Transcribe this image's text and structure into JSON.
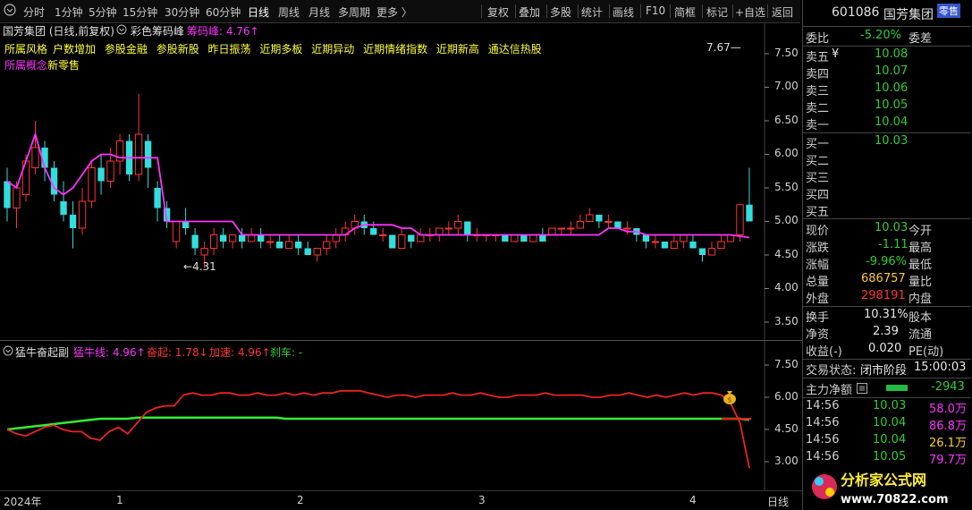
{
  "toolbar": {
    "period_tabs": [
      "分时",
      "1分钟",
      "5分钟",
      "15分钟",
      "30分钟",
      "60分钟",
      "日线",
      "周线",
      "月线",
      "多周期",
      "更多 〉"
    ],
    "active_tab": "日线",
    "tools": [
      "复权",
      "叠加",
      "多股",
      "统计",
      "画线",
      "F10",
      "简框",
      "标记",
      "+自选",
      "返回"
    ]
  },
  "main": {
    "title": "国芳集团 (日线,前复权)",
    "indicator_name": "彩色筹码峰",
    "indicator_value_label": "筹码峰: 4.76↑",
    "concepts_line1": [
      "所属风格",
      "户数增加",
      "参股金融",
      "参股新股",
      "昨日振荡",
      "近期多板",
      "近期异动",
      "近期情绪指数",
      "近期新高",
      "通达信热股"
    ],
    "concepts_line2_prefix": "所属概念",
    "concepts_line2": "新零售",
    "y_ticks": [
      "7.50",
      "7.00",
      "6.50",
      "6.00",
      "5.50",
      "5.00",
      "4.50",
      "4.00",
      "3.50"
    ],
    "low_label": "4.31",
    "high_label": "7.67"
  },
  "sub": {
    "indicator_name": "猛牛奋起副",
    "line1_label": "猛牛线: 4.96↑",
    "line2_label": "奋起: 1.78↓",
    "line3_label": "加速: 4.96↑",
    "line4_label": "刹车: -",
    "y_ticks": [
      "7.50",
      "6.00",
      "4.50",
      "3.00"
    ]
  },
  "x_axis": {
    "labels": [
      "2024年",
      "1",
      "2",
      "3",
      "4"
    ],
    "unit": "日线"
  },
  "chart_data": {
    "type": "candlestick",
    "title": "国芳集团 (日线,前复权)",
    "ylim": [
      3.2,
      7.8
    ],
    "candles": [
      {
        "o": 5.6,
        "c": 5.2,
        "h": 5.8,
        "l": 5.0
      },
      {
        "o": 5.2,
        "c": 5.5,
        "h": 5.6,
        "l": 4.9
      },
      {
        "o": 5.4,
        "c": 5.9,
        "h": 6.0,
        "l": 5.3
      },
      {
        "o": 5.8,
        "c": 6.1,
        "h": 6.5,
        "l": 5.7
      },
      {
        "o": 6.1,
        "c": 5.8,
        "h": 6.2,
        "l": 5.6
      },
      {
        "o": 5.8,
        "c": 5.4,
        "h": 5.9,
        "l": 5.3
      },
      {
        "o": 5.3,
        "c": 5.1,
        "h": 5.6,
        "l": 5.0
      },
      {
        "o": 5.1,
        "c": 4.9,
        "h": 5.3,
        "l": 4.6
      },
      {
        "o": 4.9,
        "c": 5.3,
        "h": 5.5,
        "l": 4.8
      },
      {
        "o": 5.3,
        "c": 5.8,
        "h": 5.9,
        "l": 5.2
      },
      {
        "o": 5.8,
        "c": 5.6,
        "h": 6.0,
        "l": 5.4
      },
      {
        "o": 5.6,
        "c": 5.9,
        "h": 6.1,
        "l": 5.5
      },
      {
        "o": 5.9,
        "c": 6.2,
        "h": 6.3,
        "l": 5.7
      },
      {
        "o": 6.2,
        "c": 5.7,
        "h": 6.3,
        "l": 5.6
      },
      {
        "o": 5.7,
        "c": 6.3,
        "h": 6.9,
        "l": 5.6
      },
      {
        "o": 6.2,
        "c": 5.8,
        "h": 6.3,
        "l": 5.5
      },
      {
        "o": 5.5,
        "c": 5.2,
        "h": 5.6,
        "l": 5.0
      },
      {
        "o": 5.2,
        "c": 5.0,
        "h": 5.3,
        "l": 4.9
      },
      {
        "o": 4.7,
        "c": 5.0,
        "h": 5.0,
        "l": 4.6
      },
      {
        "o": 5.0,
        "c": 4.9,
        "h": 5.2,
        "l": 4.8
      },
      {
        "o": 4.8,
        "c": 4.6,
        "h": 4.9,
        "l": 4.5
      },
      {
        "o": 4.5,
        "c": 4.6,
        "h": 4.7,
        "l": 4.31
      },
      {
        "o": 4.6,
        "c": 4.8,
        "h": 4.9,
        "l": 4.5
      },
      {
        "o": 4.8,
        "c": 4.7,
        "h": 4.9,
        "l": 4.6
      },
      {
        "o": 4.7,
        "c": 4.8,
        "h": 4.8,
        "l": 4.6
      },
      {
        "o": 4.8,
        "c": 4.7,
        "h": 4.9,
        "l": 4.6
      },
      {
        "o": 4.7,
        "c": 4.8,
        "h": 4.9,
        "l": 4.7
      },
      {
        "o": 4.8,
        "c": 4.7,
        "h": 4.9,
        "l": 4.6
      },
      {
        "o": 4.7,
        "c": 4.7,
        "h": 4.8,
        "l": 4.6
      },
      {
        "o": 4.7,
        "c": 4.6,
        "h": 4.8,
        "l": 4.6
      },
      {
        "o": 4.6,
        "c": 4.7,
        "h": 4.8,
        "l": 4.6
      },
      {
        "o": 4.7,
        "c": 4.6,
        "h": 4.8,
        "l": 4.5
      },
      {
        "o": 4.6,
        "c": 4.5,
        "h": 4.7,
        "l": 4.5
      },
      {
        "o": 4.5,
        "c": 4.6,
        "h": 4.6,
        "l": 4.4
      },
      {
        "o": 4.6,
        "c": 4.7,
        "h": 4.8,
        "l": 4.5
      },
      {
        "o": 4.7,
        "c": 4.8,
        "h": 4.9,
        "l": 4.6
      },
      {
        "o": 4.8,
        "c": 4.9,
        "h": 5.0,
        "l": 4.7
      },
      {
        "o": 4.9,
        "c": 5.0,
        "h": 5.1,
        "l": 4.8
      },
      {
        "o": 5.0,
        "c": 4.9,
        "h": 5.1,
        "l": 4.8
      },
      {
        "o": 4.9,
        "c": 4.8,
        "h": 5.0,
        "l": 4.8
      },
      {
        "o": 4.8,
        "c": 4.8,
        "h": 4.9,
        "l": 4.7
      },
      {
        "o": 4.8,
        "c": 4.6,
        "h": 4.8,
        "l": 4.6
      },
      {
        "o": 4.6,
        "c": 4.8,
        "h": 4.9,
        "l": 4.6
      },
      {
        "o": 4.8,
        "c": 4.7,
        "h": 4.8,
        "l": 4.6
      },
      {
        "o": 4.7,
        "c": 4.8,
        "h": 4.9,
        "l": 4.7
      },
      {
        "o": 4.8,
        "c": 4.8,
        "h": 4.9,
        "l": 4.7
      },
      {
        "o": 4.8,
        "c": 4.9,
        "h": 4.9,
        "l": 4.7
      },
      {
        "o": 4.9,
        "c": 4.9,
        "h": 5.0,
        "l": 4.8
      },
      {
        "o": 4.9,
        "c": 5.0,
        "h": 5.1,
        "l": 4.8
      },
      {
        "o": 5.0,
        "c": 4.8,
        "h": 5.0,
        "l": 4.7
      },
      {
        "o": 4.8,
        "c": 4.8,
        "h": 4.9,
        "l": 4.7
      },
      {
        "o": 4.8,
        "c": 4.8,
        "h": 4.8,
        "l": 4.7
      },
      {
        "o": 4.8,
        "c": 4.8,
        "h": 4.8,
        "l": 4.7
      },
      {
        "o": 4.8,
        "c": 4.7,
        "h": 4.8,
        "l": 4.7
      },
      {
        "o": 4.7,
        "c": 4.8,
        "h": 4.8,
        "l": 4.7
      },
      {
        "o": 4.8,
        "c": 4.7,
        "h": 4.8,
        "l": 4.7
      },
      {
        "o": 4.7,
        "c": 4.8,
        "h": 4.8,
        "l": 4.7
      },
      {
        "o": 4.8,
        "c": 4.7,
        "h": 4.9,
        "l": 4.7
      },
      {
        "o": 4.8,
        "c": 4.9,
        "h": 4.9,
        "l": 4.8
      },
      {
        "o": 4.9,
        "c": 4.9,
        "h": 4.9,
        "l": 4.8
      },
      {
        "o": 4.9,
        "c": 4.9,
        "h": 5.0,
        "l": 4.8
      },
      {
        "o": 4.9,
        "c": 5.0,
        "h": 5.1,
        "l": 4.9
      },
      {
        "o": 5.0,
        "c": 5.1,
        "h": 5.2,
        "l": 5.0
      },
      {
        "o": 5.1,
        "c": 5.0,
        "h": 5.1,
        "l": 4.9
      },
      {
        "o": 5.0,
        "c": 5.0,
        "h": 5.1,
        "l": 4.9
      },
      {
        "o": 5.0,
        "c": 4.9,
        "h": 5.0,
        "l": 4.9
      },
      {
        "o": 4.9,
        "c": 4.9,
        "h": 5.0,
        "l": 4.8
      },
      {
        "o": 4.9,
        "c": 4.8,
        "h": 4.9,
        "l": 4.7
      },
      {
        "o": 4.8,
        "c": 4.7,
        "h": 4.8,
        "l": 4.6
      },
      {
        "o": 4.7,
        "c": 4.7,
        "h": 4.8,
        "l": 4.6
      },
      {
        "o": 4.7,
        "c": 4.6,
        "h": 4.7,
        "l": 4.6
      },
      {
        "o": 4.6,
        "c": 4.7,
        "h": 4.8,
        "l": 4.6
      },
      {
        "o": 4.7,
        "c": 4.8,
        "h": 4.8,
        "l": 4.6
      },
      {
        "o": 4.7,
        "c": 4.6,
        "h": 4.8,
        "l": 4.6
      },
      {
        "o": 4.6,
        "c": 4.5,
        "h": 4.6,
        "l": 4.4
      },
      {
        "o": 4.5,
        "c": 4.6,
        "h": 4.7,
        "l": 4.5
      },
      {
        "o": 4.6,
        "c": 4.7,
        "h": 4.8,
        "l": 4.6
      },
      {
        "o": 4.7,
        "c": 4.8,
        "h": 4.8,
        "l": 4.7
      },
      {
        "o": 4.8,
        "c": 5.25,
        "h": 5.25,
        "l": 4.7
      },
      {
        "o": 5.25,
        "c": 5.0,
        "h": 5.8,
        "l": 5.0
      }
    ],
    "chip_peak_line": [
      5.6,
      5.5,
      5.9,
      6.3,
      5.8,
      5.5,
      5.4,
      5.5,
      5.7,
      5.9,
      6.0,
      6.0,
      5.95,
      5.95,
      5.95,
      5.95,
      5.95,
      5.0,
      5.0,
      5.0,
      5.0,
      5.0,
      5.0,
      5.0,
      5.0,
      4.8,
      4.8,
      4.8,
      4.8,
      4.8,
      4.8,
      4.8,
      4.8,
      4.8,
      4.8,
      4.8,
      4.8,
      4.9,
      4.95,
      4.95,
      4.95,
      4.95,
      4.9,
      4.9,
      4.8,
      4.8,
      4.8,
      4.8,
      4.8,
      4.8,
      4.8,
      4.8,
      4.8,
      4.8,
      4.8,
      4.8,
      4.8,
      4.8,
      4.8,
      4.8,
      4.8,
      4.8,
      4.8,
      4.8,
      4.9,
      4.9,
      4.85,
      4.85,
      4.8,
      4.8,
      4.8,
      4.8,
      4.8,
      4.8,
      4.8,
      4.8,
      4.8,
      4.8,
      4.78,
      4.76
    ],
    "sub_series": {
      "ylim": [
        2.5,
        8.0
      ],
      "red": [
        4.5,
        4.3,
        4.2,
        4.4,
        4.6,
        4.7,
        4.5,
        4.4,
        4.4,
        4.1,
        4.0,
        4.4,
        4.6,
        4.3,
        4.8,
        5.3,
        5.5,
        5.6,
        5.6,
        6.1,
        6.2,
        6.1,
        6.1,
        6.2,
        6.2,
        6.1,
        6.1,
        6.2,
        6.1,
        6.1,
        6.2,
        6.1,
        6.2,
        6.1,
        6.2,
        6.2,
        6.3,
        6.3,
        6.3,
        6.2,
        6.1,
        6.0,
        6.1,
        6.1,
        6.0,
        6.1,
        6.1,
        6.1,
        6.2,
        6.1,
        6.1,
        6.2,
        6.1,
        6.0,
        6.0,
        6.1,
        6.1,
        6.1,
        6.2,
        6.1,
        6.1,
        6.1,
        6.1,
        6.0,
        6.0,
        6.1,
        6.1,
        6.2,
        6.1,
        6.0,
        6.1,
        6.0,
        6.1,
        6.2,
        6.1,
        6.2,
        6.2,
        6.1,
        5.7,
        4.8,
        2.7
      ],
      "green": [
        4.5,
        4.55,
        4.6,
        4.65,
        4.7,
        4.75,
        4.8,
        4.85,
        4.9,
        4.95,
        5.0,
        5.0,
        5.0,
        5.0,
        5.05,
        5.05,
        5.05,
        5.05,
        5.05,
        5.05,
        5.05,
        5.05,
        5.05,
        5.05,
        5.05,
        5.05,
        5.05,
        5.05,
        5.05,
        5.05,
        5.0,
        5.0,
        5.0,
        5.0,
        5.0,
        5.0,
        5.0,
        5.0,
        5.0,
        5.0,
        5.0,
        5.0,
        5.0,
        5.0,
        5.0,
        5.0,
        5.0,
        5.0,
        5.0,
        5.0,
        5.0,
        5.0,
        5.0,
        5.0,
        5.0,
        5.0,
        5.0,
        5.0,
        5.0,
        5.0,
        5.0,
        5.0,
        5.0,
        5.0,
        5.0,
        5.0,
        5.0,
        5.0,
        5.0,
        5.0,
        5.0,
        5.0,
        5.0,
        5.0,
        5.0,
        5.0,
        5.0,
        5.0,
        5.0,
        5.0,
        4.96
      ],
      "level_line": 5.0
    }
  },
  "quote": {
    "code": "601086",
    "name": "国芳集团",
    "status_tag": "零售",
    "weibi_label": "委比",
    "weibi_value": "-5.20%",
    "weicha_label": "委差",
    "sells": [
      {
        "label": "卖五",
        "flag": "¥",
        "price": "10.08"
      },
      {
        "label": "卖四",
        "flag": "",
        "price": "10.07"
      },
      {
        "label": "卖三",
        "flag": "",
        "price": "10.06"
      },
      {
        "label": "卖二",
        "flag": "",
        "price": "10.05"
      },
      {
        "label": "卖一",
        "flag": "",
        "price": "10.04"
      }
    ],
    "buys": [
      {
        "label": "买一",
        "price": "10.03"
      },
      {
        "label": "买二",
        "price": ""
      },
      {
        "label": "买三",
        "price": ""
      },
      {
        "label": "买四",
        "price": ""
      },
      {
        "label": "买五",
        "price": ""
      }
    ],
    "stats": [
      {
        "l1": "现价",
        "v1": "10.03",
        "c1": "green",
        "l2": "今开"
      },
      {
        "l1": "涨跌",
        "v1": "-1.11",
        "c1": "green",
        "l2": "最高"
      },
      {
        "l1": "涨幅",
        "v1": "-9.96%",
        "c1": "green",
        "l2": "最低"
      },
      {
        "l1": "总量",
        "v1": "686757",
        "c1": "yellow",
        "l2": "量比"
      },
      {
        "l1": "外盘",
        "v1": "298191",
        "c1": "red",
        "l2": "内盘"
      }
    ],
    "stats2": [
      {
        "l1": "换手",
        "v1": "10.31%",
        "c1": "white",
        "l2": "股本"
      },
      {
        "l1": "净资",
        "v1": "2.39",
        "c1": "white",
        "l2": "流通"
      },
      {
        "l1": "收益(-)",
        "v1": "0.020",
        "c1": "white",
        "l2": "PE(动)"
      }
    ],
    "trade_status_label": "交易状态:",
    "trade_status": "闭市阶段",
    "trade_time": "15:00:03",
    "main_net_label": "主力净额",
    "main_net_value": "-2943",
    "ticks": [
      {
        "time": "14:56",
        "price": "10.03",
        "vol": "58.0万",
        "vc": "magenta"
      },
      {
        "time": "14:56",
        "price": "10.04",
        "vol": "86.8万",
        "vc": "magenta"
      },
      {
        "time": "14:56",
        "price": "10.04",
        "vol": "26.1万",
        "vc": "yellow"
      },
      {
        "time": "14:56",
        "price": "10.05",
        "vol": "79.7万",
        "vc": "magenta"
      }
    ]
  },
  "watermark": {
    "brand": "分析家公式网",
    "url": "www.70822.com"
  }
}
